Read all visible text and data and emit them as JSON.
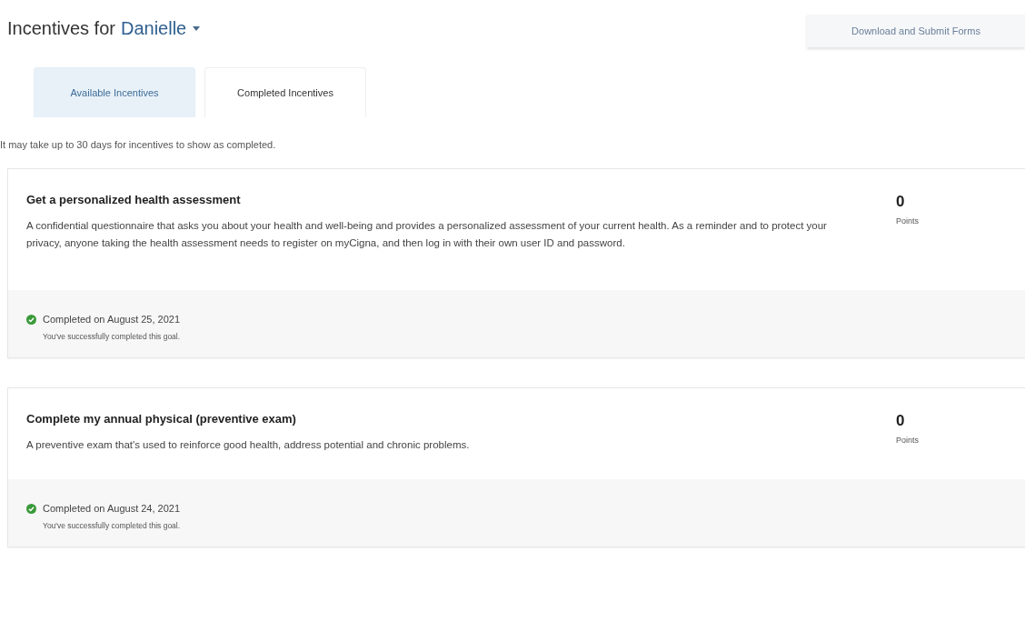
{
  "header": {
    "title": "Incentives for",
    "person": "Danielle",
    "action_button": "Download and Submit Forms"
  },
  "tabs": [
    {
      "label": "Available Incentives",
      "selected": true
    },
    {
      "label": "Completed Incentives",
      "selected": false
    }
  ],
  "note": "It may take up to 30 days for incentives to show as completed.",
  "incentives": [
    {
      "title": "Get a personalized health assessment",
      "description": "A confidential questionnaire that asks you about your health and well-being and provides a personalized assessment of your current health. As a reminder and to protect your privacy, anyone taking the health assessment needs to register on myCigna, and then log in with their own user ID and password.",
      "points": "0",
      "points_label": "Points",
      "completed": true,
      "status": "Completed on August 25, 2021",
      "status_detail": "You've successfully completed this goal."
    },
    {
      "title": "Complete my annual physical (preventive exam)",
      "description": "A preventive exam that's used to reinforce good health, address potential and chronic problems.",
      "points": "0",
      "points_label": "Points",
      "completed": true,
      "status": "Completed on August 24, 2021",
      "status_detail": "You've successfully completed this goal."
    }
  ]
}
